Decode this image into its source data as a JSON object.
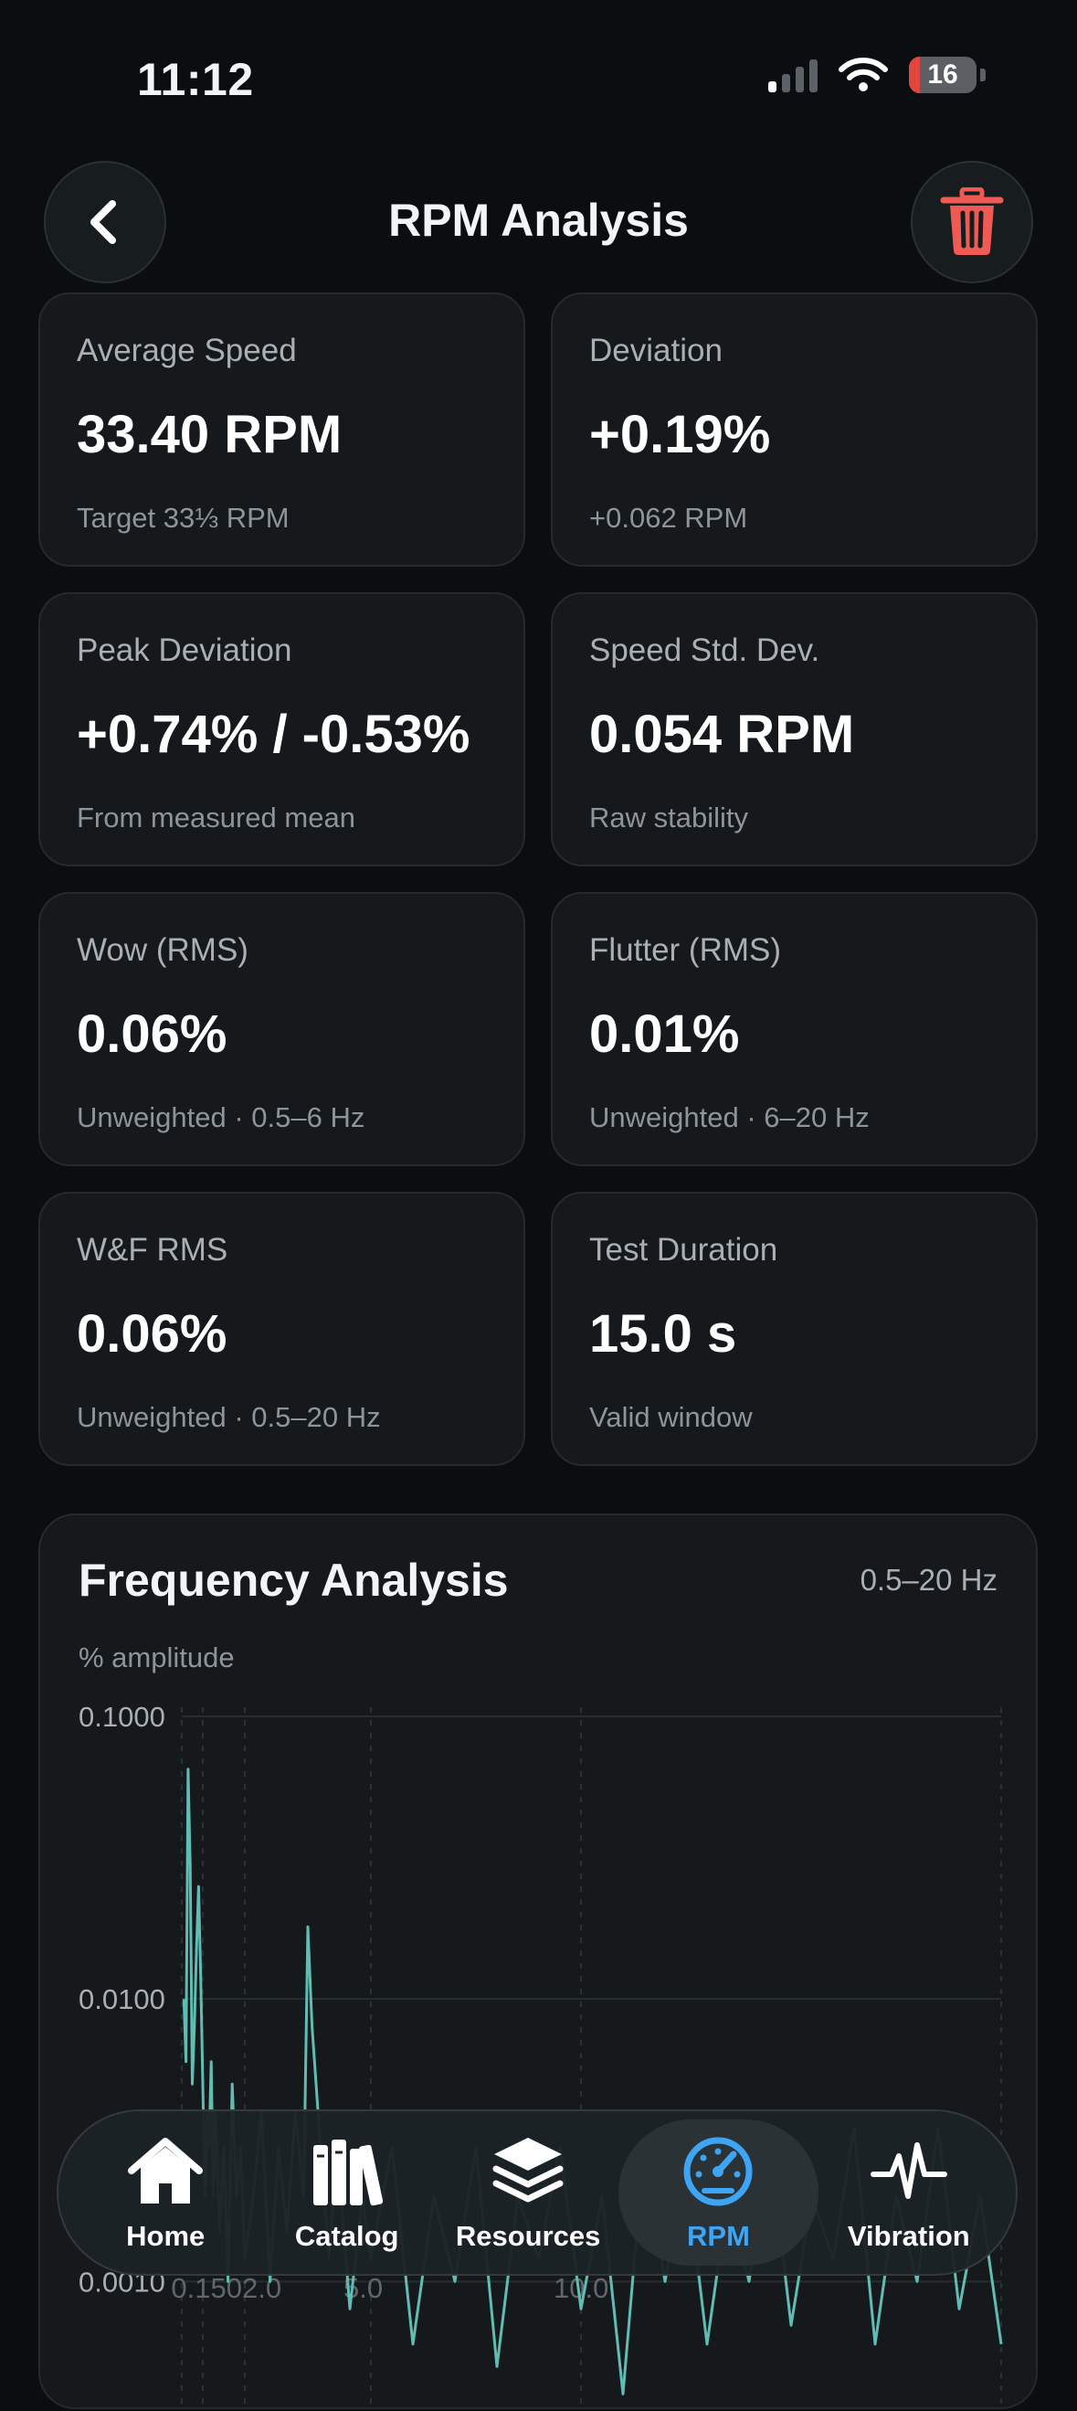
{
  "status": {
    "time": "11:12",
    "battery": "16"
  },
  "header": {
    "title": "RPM Analysis"
  },
  "cards": [
    {
      "label": "Average Speed",
      "value": "33.40 RPM",
      "sub": "Target 33⅓ RPM"
    },
    {
      "label": "Deviation",
      "value": "+0.19%",
      "sub": "+0.062 RPM"
    },
    {
      "label": "Peak Deviation",
      "value": "+0.74% / -0.53%",
      "sub": "From measured mean"
    },
    {
      "label": "Speed Std. Dev.",
      "value": "0.054 RPM",
      "sub": "Raw stability"
    },
    {
      "label": "Wow (RMS)",
      "value": "0.06%",
      "sub": "Unweighted · 0.5–6 Hz"
    },
    {
      "label": "Flutter (RMS)",
      "value": "0.01%",
      "sub": "Unweighted · 6–20 Hz"
    },
    {
      "label": "W&F RMS",
      "value": "0.06%",
      "sub": "Unweighted · 0.5–20 Hz"
    },
    {
      "label": "Test Duration",
      "value": "15.0 s",
      "sub": "Valid window"
    }
  ],
  "frequency": {
    "title": "Frequency Analysis",
    "range": "0.5–20 Hz",
    "ylabel": "% amplitude"
  },
  "chart_data": {
    "type": "line",
    "title": "Frequency Analysis",
    "ylabel": "% amplitude",
    "yscale": "log",
    "ylim": [
      0.0003,
      0.1
    ],
    "xlim": [
      0.5,
      20
    ],
    "yticks": [
      "0.1000",
      "0.0100",
      "0.0010"
    ],
    "xticks": [
      "0.5",
      "1.0",
      "2.0",
      "5.0",
      "10.0"
    ],
    "xticks_visible_text": [
      "0.1502.0",
      "5.0",
      "10.0"
    ],
    "line_color": "#5fbdb3",
    "series": [
      {
        "x": [
          0.55,
          0.6,
          0.65,
          0.7,
          0.75,
          0.8,
          0.85,
          0.9,
          0.95,
          1.0,
          1.05,
          1.1,
          1.15,
          1.2,
          1.25,
          1.3,
          1.4,
          1.5,
          1.6,
          1.7,
          1.8,
          1.9,
          2.0,
          2.2,
          2.4,
          2.6,
          2.8,
          3.0,
          3.2,
          3.4,
          3.5,
          3.6,
          3.8,
          4.0,
          4.2,
          4.5,
          4.8,
          5.0,
          5.5,
          6.0,
          6.5,
          7.0,
          7.5,
          8.0,
          8.5,
          9.0,
          9.5,
          10.0,
          10.5,
          11.0,
          11.5,
          12.0,
          12.5,
          13.0,
          13.5,
          14.0,
          14.5,
          15.0,
          15.5,
          16.0,
          16.5,
          17.0,
          17.5,
          18.0,
          18.5,
          19.0,
          19.5,
          20.0
        ],
        "y": [
          0.01,
          0.006,
          0.065,
          0.03,
          0.005,
          0.008,
          0.015,
          0.025,
          0.012,
          0.005,
          0.002,
          0.004,
          0.003,
          0.006,
          0.002,
          0.004,
          0.0015,
          0.003,
          0.001,
          0.005,
          0.002,
          0.003,
          0.0012,
          0.002,
          0.004,
          0.001,
          0.003,
          0.0015,
          0.004,
          0.002,
          0.018,
          0.008,
          0.003,
          0.0012,
          0.003,
          0.0008,
          0.002,
          0.0012,
          0.003,
          0.0006,
          0.002,
          0.001,
          0.003,
          0.0005,
          0.002,
          0.0012,
          0.003,
          0.0008,
          0.002,
          0.0004,
          0.003,
          0.001,
          0.0025,
          0.0006,
          0.002,
          0.001,
          0.003,
          0.0007,
          0.002,
          0.0012,
          0.0035,
          0.0006,
          0.002,
          0.001,
          0.0035,
          0.0008,
          0.002,
          0.0006
        ]
      }
    ]
  },
  "tabs": [
    {
      "label": "Home",
      "icon": "house-icon"
    },
    {
      "label": "Catalog",
      "icon": "books-icon"
    },
    {
      "label": "Resources",
      "icon": "layers-icon"
    },
    {
      "label": "RPM",
      "icon": "gauge-icon",
      "active": true
    },
    {
      "label": "Vibration",
      "icon": "pulse-icon"
    }
  ]
}
